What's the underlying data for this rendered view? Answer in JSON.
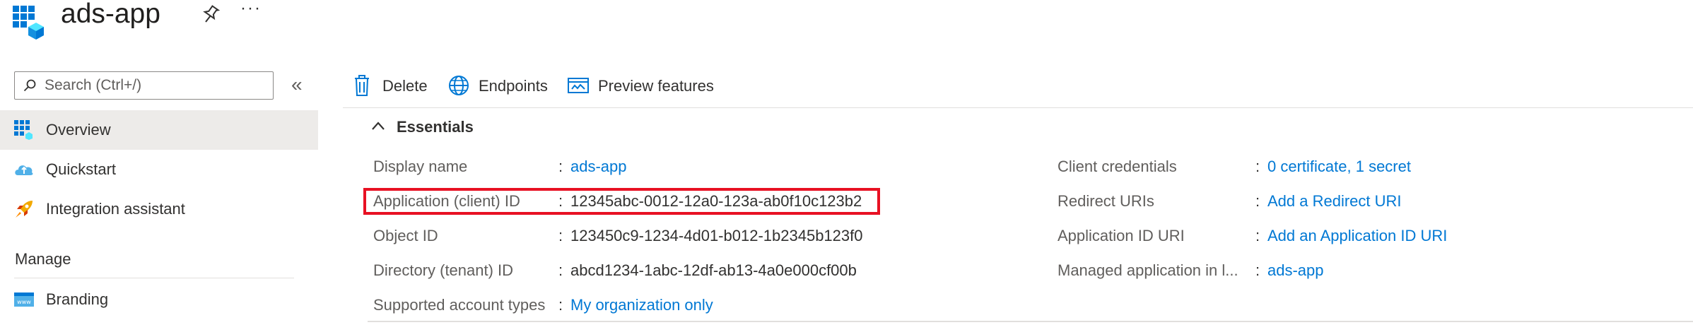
{
  "header": {
    "title": "ads-app",
    "more_label": "···"
  },
  "search": {
    "placeholder": "Search (Ctrl+/)",
    "collapse_label": "«"
  },
  "sidebar": {
    "items": [
      {
        "label": "Overview",
        "icon": "overview-icon",
        "selected": true
      },
      {
        "label": "Quickstart",
        "icon": "quickstart-icon",
        "selected": false
      },
      {
        "label": "Integration assistant",
        "icon": "rocket-icon",
        "selected": false
      }
    ],
    "section_manage": "Manage",
    "manage_items": [
      {
        "label": "Branding",
        "icon": "branding-icon"
      }
    ]
  },
  "toolbar": {
    "delete_label": "Delete",
    "endpoints_label": "Endpoints",
    "preview_label": "Preview features"
  },
  "essentials": {
    "heading": "Essentials",
    "left": [
      {
        "label": "Display name",
        "value": "ads-app",
        "is_link": true
      },
      {
        "label": "Application (client) ID",
        "value": "12345abc-0012-12a0-123a-ab0f10c123b2",
        "is_link": false
      },
      {
        "label": "Object ID",
        "value": "123450c9-1234-4d01-b012-1b2345b123f0",
        "is_link": false
      },
      {
        "label": "Directory (tenant) ID",
        "value": "abcd1234-1abc-12df-ab13-4a0e000cf00b",
        "is_link": false
      },
      {
        "label": "Supported account types",
        "value": "My organization only",
        "is_link": true
      }
    ],
    "right": [
      {
        "label": "Client credentials",
        "value": "0 certificate, 1 secret",
        "is_link": true
      },
      {
        "label": "Redirect URIs",
        "value": "Add a Redirect URI",
        "is_link": true
      },
      {
        "label": "Application ID URI",
        "value": "Add an Application ID URI",
        "is_link": true
      },
      {
        "label": "Managed application in l...",
        "value": "ads-app",
        "is_link": true
      }
    ],
    "colon": ":"
  },
  "colors": {
    "accent": "#0078d4",
    "highlight_border": "#e81123",
    "selected_nav_bg": "#edebe9"
  }
}
